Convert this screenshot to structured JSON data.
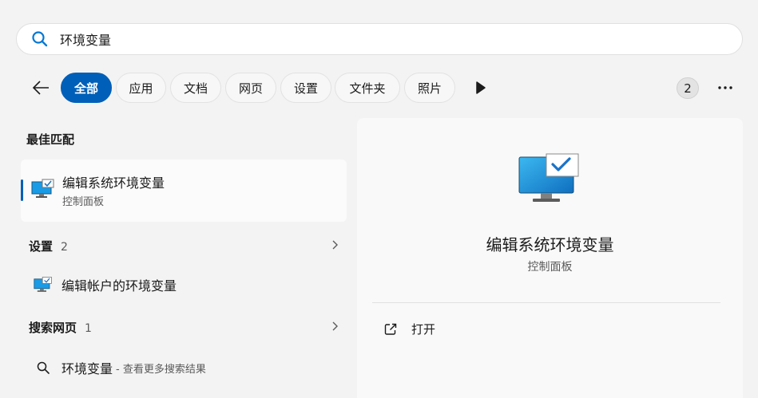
{
  "search": {
    "query": "环境变量"
  },
  "filters": {
    "chips": [
      {
        "label": "全部",
        "active": true
      },
      {
        "label": "应用"
      },
      {
        "label": "文档"
      },
      {
        "label": "网页"
      },
      {
        "label": "设置"
      },
      {
        "label": "文件夹"
      },
      {
        "label": "照片"
      }
    ],
    "count_badge": "2"
  },
  "best_match": {
    "heading": "最佳匹配",
    "title": "编辑系统环境变量",
    "subtitle": "控制面板"
  },
  "settings_section": {
    "heading": "设置",
    "count": "2",
    "items": [
      {
        "label": "编辑帐户的环境变量"
      }
    ]
  },
  "web_section": {
    "heading": "搜索网页",
    "count": "1",
    "items": [
      {
        "label": "环境变量",
        "hint": "- 查看更多搜索结果"
      }
    ]
  },
  "detail": {
    "title": "编辑系统环境变量",
    "subtitle": "控制面板",
    "actions": [
      {
        "label": "打开"
      }
    ]
  },
  "colors": {
    "accent": "#005fb8",
    "icon_blue": "#1a9be6"
  }
}
